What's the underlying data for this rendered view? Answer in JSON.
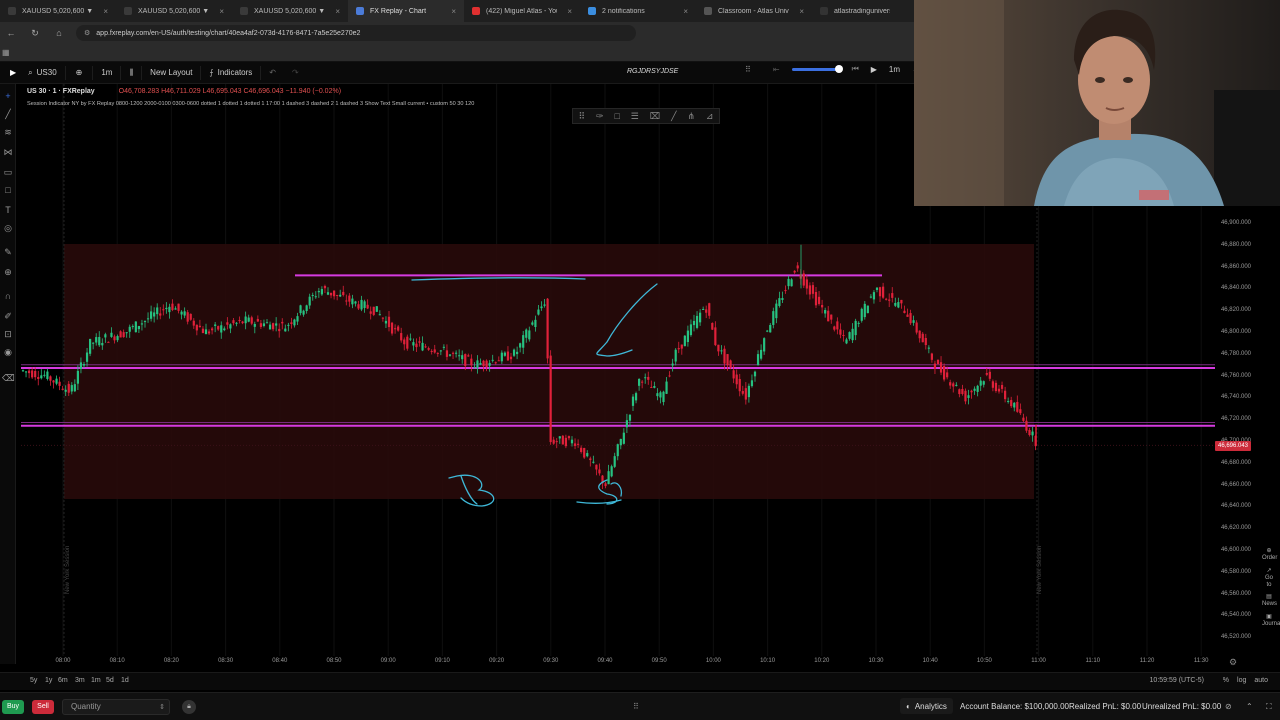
{
  "browser": {
    "tabs": [
      {
        "label": "XAUUSD 5,020,600 ▼ -1.15",
        "color": "#3a3a3a",
        "active": false
      },
      {
        "label": "XAUUSD 5,020,600 ▼ -1.15",
        "color": "#3a3a3a",
        "active": false
      },
      {
        "label": "XAUUSD 5,020,600 ▼ -1.15",
        "color": "#3a3a3a",
        "active": false
      },
      {
        "label": "FX Replay - Chart",
        "color": "#4b7bd8",
        "active": true
      },
      {
        "label": "(422) Miguel Atlas - YouTub",
        "color": "#e03030",
        "active": false
      },
      {
        "label": "2 notifications",
        "color": "#3b8ee0",
        "active": false
      },
      {
        "label": "Classroom - Atlas University",
        "color": "#555555",
        "active": false
      },
      {
        "label": "atlastradinguniversity (@atl",
        "color": "#333333",
        "active": false
      }
    ],
    "url": "app.fxreplay.com/en-US/auth/testing/chart/40ea4af2-073d-4176-8471-7a5e25e270e2"
  },
  "toolbar": {
    "symbol": "US30",
    "interval": "1m",
    "new_layout": "New Layout",
    "indicators": "Indicators",
    "layout_name": "RGJDRSYJDSE",
    "replay_interval": "1m"
  },
  "chart": {
    "title": "US 30 · 1 · FXReplay",
    "ohlc": "O46,708.283 H46,711.029 L46,695.043 C46,696.043 −11.940 (−0.02%)",
    "session_indicator": "Session Indicator NY by FX Replay 0800-1200 2000-0100 0300-0600 dotted 1 dotted 1 dotted 1 17:00 1 dashed 3 dashed 2 1 dashed 3 Show Text Small current • custom 50 30 120",
    "last_price_label": "46,696.043",
    "price_ticks": [
      "46,900.000",
      "46,880.000",
      "46,860.000",
      "46,840.000",
      "46,820.000",
      "46,800.000",
      "46,780.000",
      "46,760.000",
      "46,740.000",
      "46,720.000",
      "46,700.000",
      "46,680.000",
      "46,660.000",
      "46,640.000",
      "46,620.000",
      "46,600.000",
      "46,580.000",
      "46,560.000",
      "46,540.000",
      "46,520.000"
    ],
    "time_ticks": [
      "08:00",
      "08:10",
      "08:20",
      "08:30",
      "08:40",
      "08:50",
      "09:00",
      "09:10",
      "09:20",
      "09:30",
      "09:40",
      "09:50",
      "10:00",
      "10:10",
      "10:20",
      "10:30",
      "10:40",
      "10:50",
      "11:00",
      "11:10",
      "11:20",
      "11:30"
    ],
    "session_label": "New York Session",
    "colors": {
      "up": "#26c281",
      "down": "#e0213a",
      "level": "#d63be0",
      "drawing": "#3fb8d8",
      "session_box": "#2a0b0b"
    }
  },
  "bottom": {
    "ranges": [
      "5y",
      "1y",
      "6m",
      "3m",
      "1m",
      "5d",
      "1d"
    ],
    "clock": "10:59:59 (UTC-5)",
    "scale_opts": [
      "%",
      "log",
      "auto"
    ],
    "buy": "Buy",
    "sell": "Sell",
    "quantity_placeholder": "Quantity",
    "analytics": "Analytics",
    "account_balance": "Account Balance: $100,000.00",
    "realized_pnl": "Realized PnL: $0.00",
    "unrealized_pnl": "Unrealized PnL: $0.00"
  }
}
